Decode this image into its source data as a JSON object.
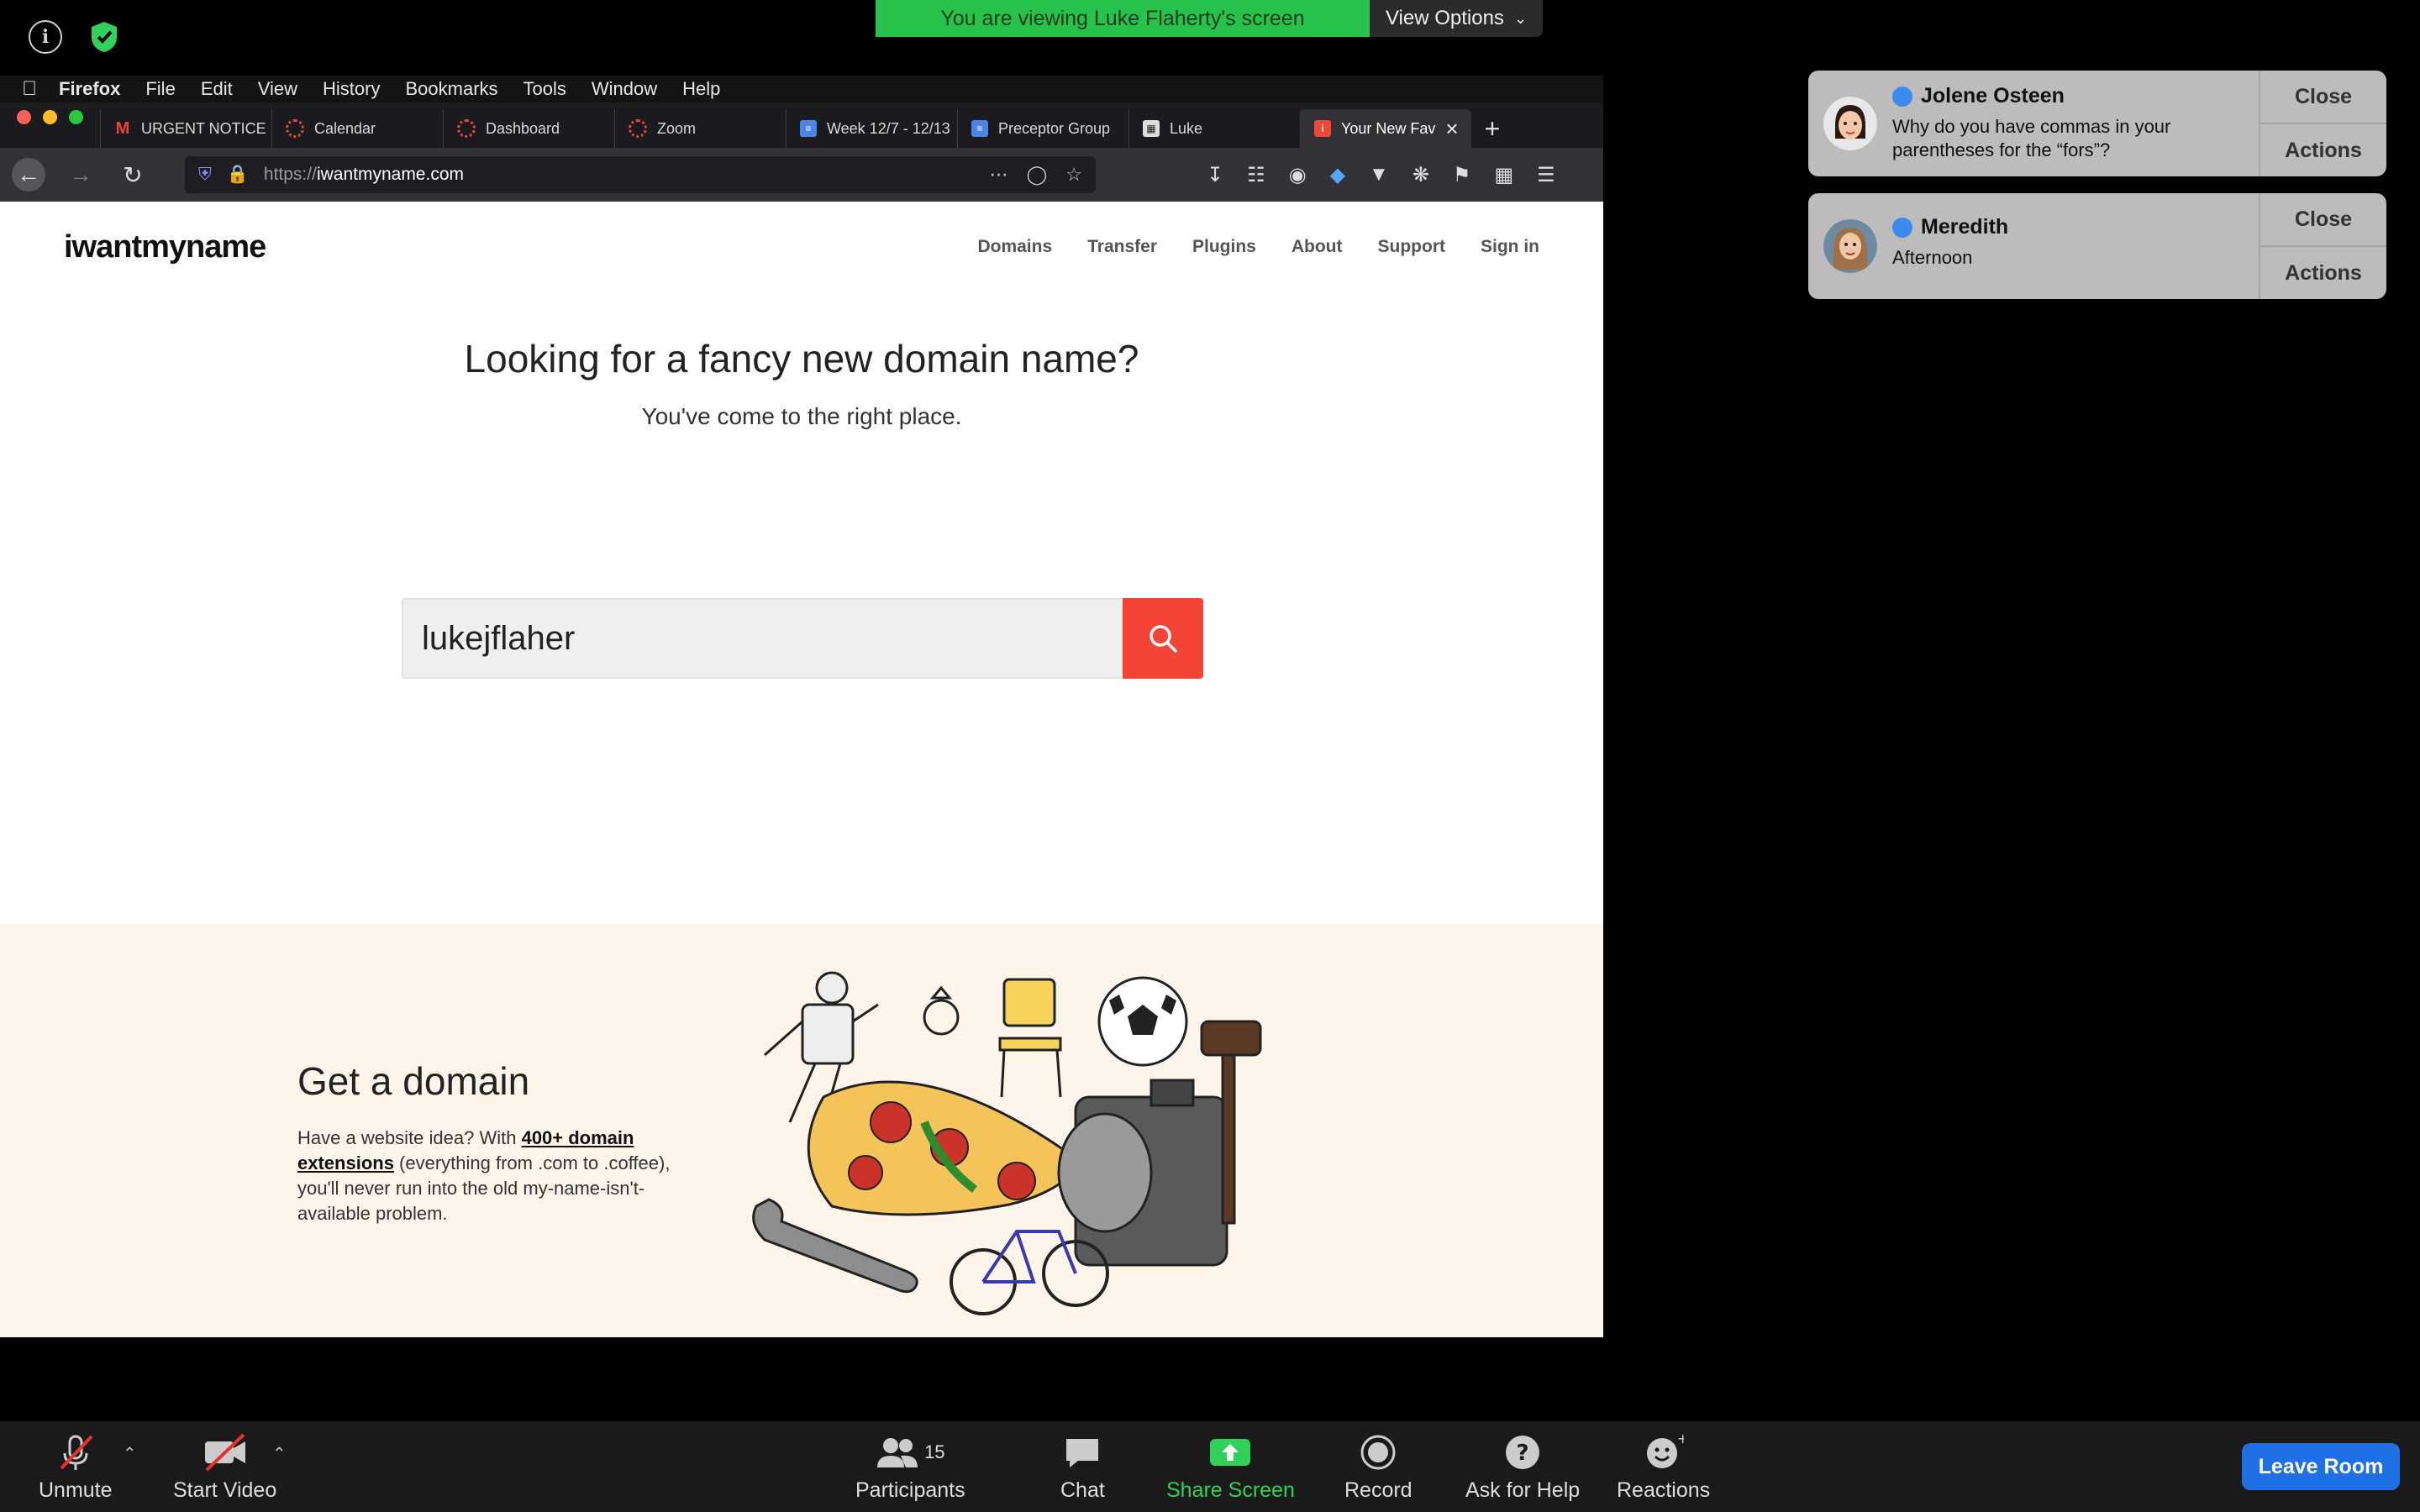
{
  "zoom": {
    "banner": "You are viewing Luke Flaherty's screen",
    "view_options": "View Options",
    "toolbar": {
      "unmute": "Unmute",
      "start_video": "Start Video",
      "participants": "Participants",
      "participants_count": "15",
      "chat": "Chat",
      "share_screen": "Share Screen",
      "record": "Record",
      "ask_for_help": "Ask for Help",
      "reactions": "Reactions",
      "leave_room": "Leave Room"
    }
  },
  "mac_menu": [
    "Firefox",
    "File",
    "Edit",
    "View",
    "History",
    "Bookmarks",
    "Tools",
    "Window",
    "Help"
  ],
  "browser": {
    "tabs": [
      {
        "label": "URGENT NOTICE",
        "icon": "gmail-icon"
      },
      {
        "label": "Calendar",
        "icon": "canvas-icon"
      },
      {
        "label": "Dashboard",
        "icon": "canvas-icon"
      },
      {
        "label": "Zoom",
        "icon": "canvas-icon"
      },
      {
        "label": "Week 12/7 - 12/13",
        "icon": "docs-icon"
      },
      {
        "label": "Preceptor Group",
        "icon": "docs-icon"
      },
      {
        "label": "Luke",
        "icon": "site-icon"
      },
      {
        "label": "Your New Fav",
        "icon": "iwmn-icon"
      }
    ],
    "url": "https://iwantmyname.com",
    "url_prefix": "https://",
    "url_domain": "iwantmyname.com"
  },
  "site": {
    "logo": "iwantmyname",
    "nav": [
      "Domains",
      "Transfer",
      "Plugins",
      "About",
      "Support",
      "Sign in"
    ],
    "hero_title": "Looking for a fancy new domain name?",
    "hero_subtitle": "You've come to the right place.",
    "search_value": "lukejflaher",
    "get_domain_title": "Get a domain",
    "get_domain_text_1": "Have a website idea? With ",
    "get_domain_link": "400+ domain extensions",
    "get_domain_text_2": " (everything from .com to .coffee), you'll never run into the old my-name-isn't-available problem."
  },
  "notifications": [
    {
      "name": "Jolene Osteen",
      "text": "Why do you have commas in your parentheses for the “fors”?",
      "close": "Close",
      "actions": "Actions"
    },
    {
      "name": "Meredith",
      "text": "Afternoon",
      "close": "Close",
      "actions": "Actions"
    }
  ],
  "colors": {
    "zoom_green": "#27c24c",
    "search_red": "#f34436",
    "leave_blue": "#1f6fe6",
    "promo_bg": "#fef5ea"
  }
}
